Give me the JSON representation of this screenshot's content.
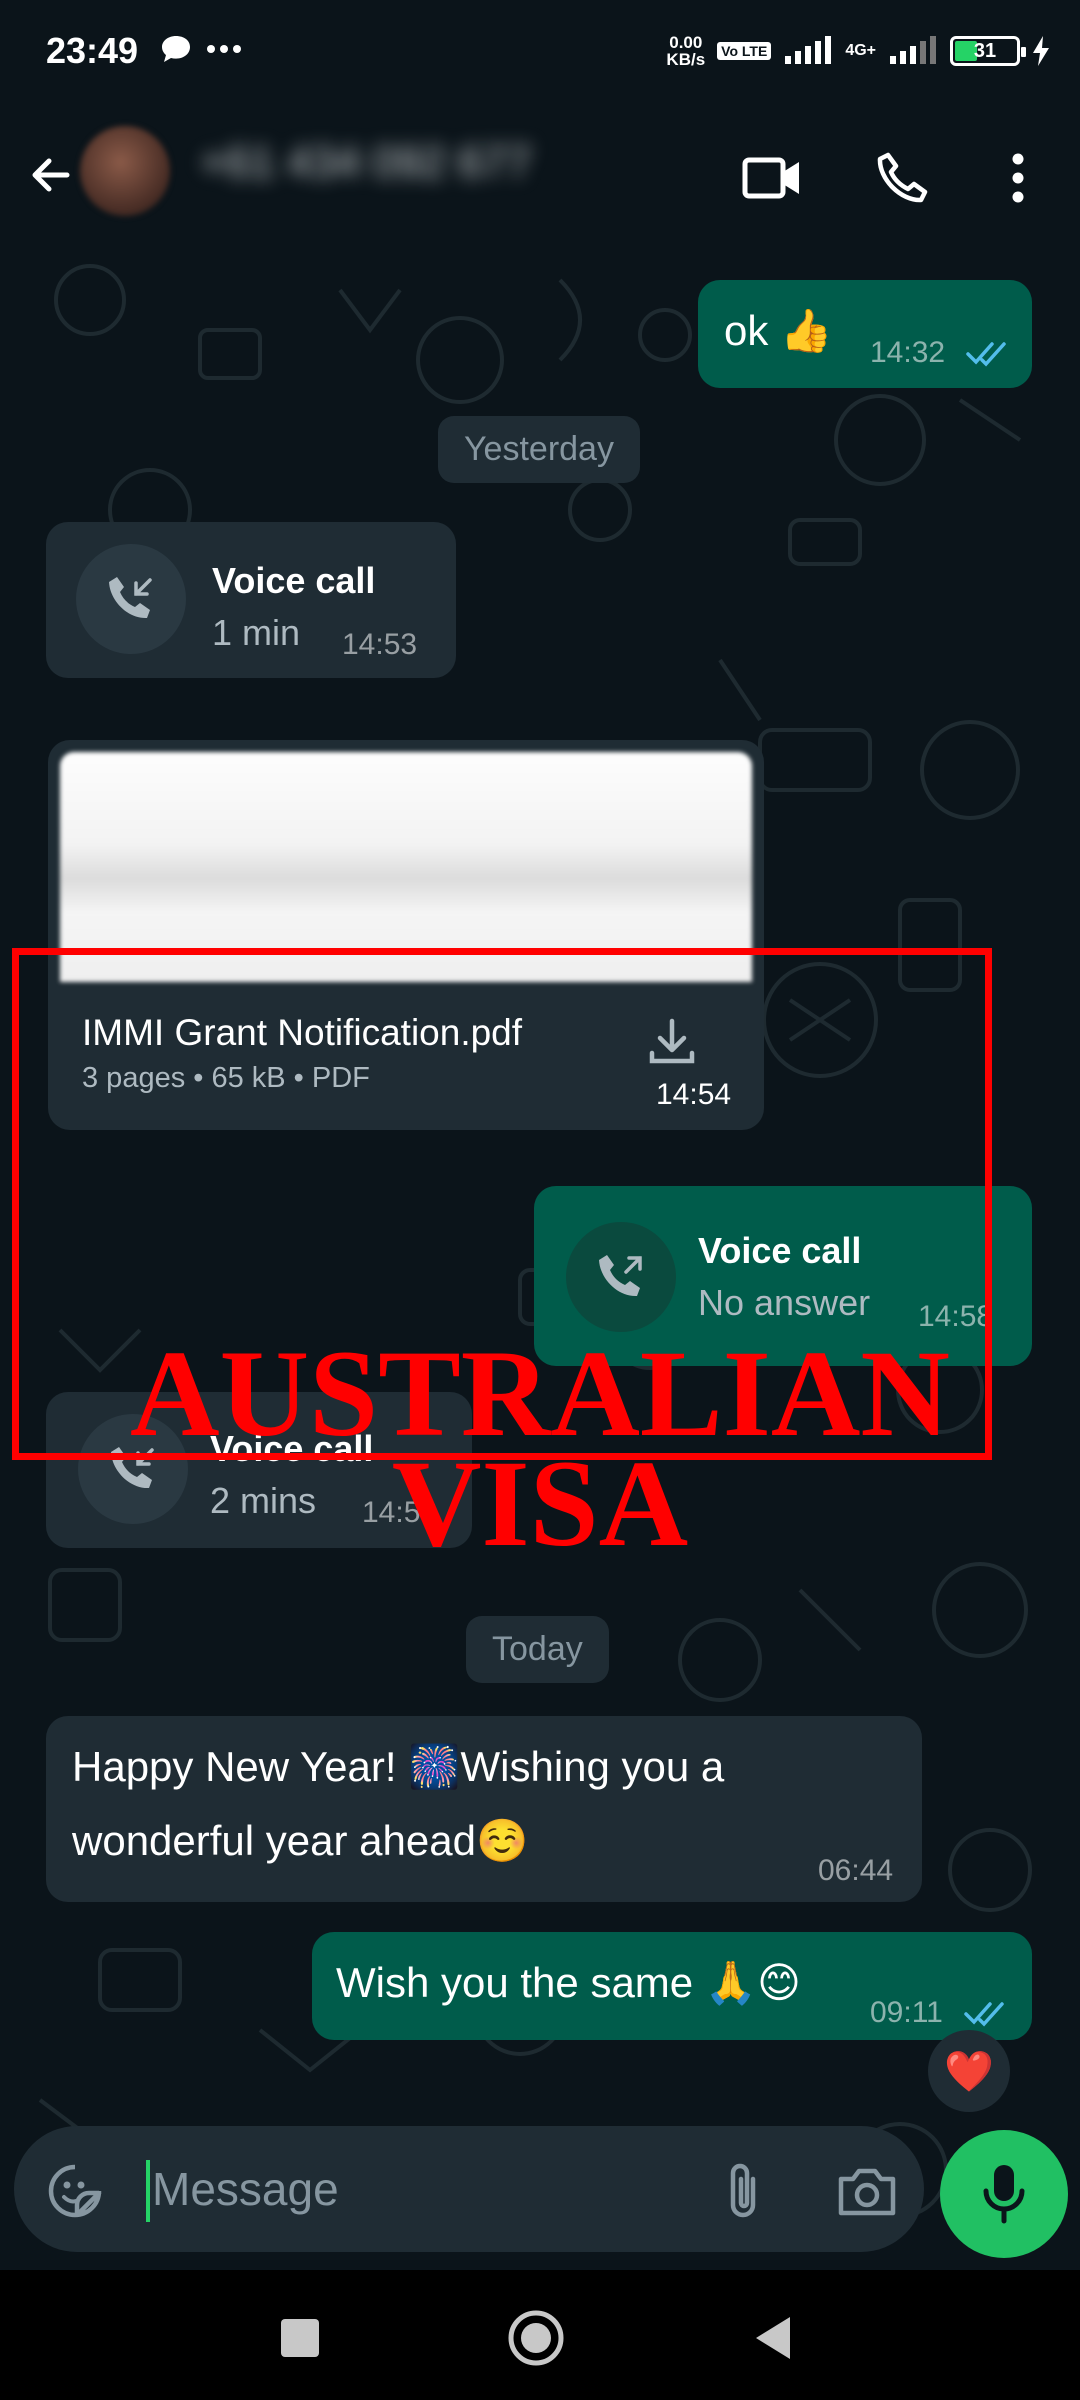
{
  "status_bar": {
    "time": "23:49",
    "network_speed": "0.00",
    "network_speed_unit": "KB/s",
    "volte_tag": "Vo LTE",
    "network_type": "4G+",
    "battery": "31"
  },
  "header": {
    "contact_name": "+61 434 092 677",
    "back_icon": "arrow-left-icon",
    "video_icon": "video-call-icon",
    "call_icon": "phone-icon",
    "menu_icon": "more-vertical-icon"
  },
  "messages": {
    "ok": {
      "text": "ok 👍",
      "time": "14:32"
    },
    "date_yesterday": "Yesterday",
    "call1": {
      "title": "Voice call",
      "sub": "1 min",
      "time": "14:53"
    },
    "doc": {
      "name": "IMMI Grant Notification.pdf",
      "meta": "3 pages • 65 kB • PDF",
      "time": "14:54"
    },
    "call2": {
      "title": "Voice call",
      "sub": "No answer",
      "time": "14:58"
    },
    "call3": {
      "title": "Voice call",
      "sub": "2 mins",
      "time": "14:56"
    },
    "date_today": "Today",
    "newyear": {
      "line1": "Happy New Year! 🎆Wishing you a",
      "line2": "wonderful year ahead☺️",
      "time": "06:44"
    },
    "reply": {
      "text": "Wish you the same 🙏😊",
      "time": "09:11",
      "reaction": "❤️"
    }
  },
  "overlay": {
    "line1": "AUSTRALIAN",
    "line2": "VISA"
  },
  "input": {
    "placeholder": "Message"
  },
  "colors": {
    "incoming": "#1f2c34",
    "outgoing": "#005c4b",
    "accent": "#21c063",
    "highlight": "#ff0000"
  }
}
